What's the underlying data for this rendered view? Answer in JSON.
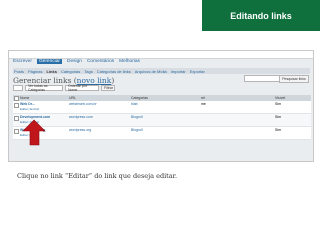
{
  "slide": {
    "title": "Editando links",
    "caption": "Clique no link “Editar” do link que deseja editar."
  },
  "menu": {
    "items": [
      "Escrever",
      "Gerenciar",
      "Design",
      "Comentários",
      "Melhorias"
    ],
    "active": "Gerenciar"
  },
  "submenu": {
    "items": [
      "Posts",
      "Páginas",
      "Links",
      "Categorias",
      "Tags",
      "Categorias de links",
      "Arquivos de Mídia",
      "Importar",
      "Exportar"
    ],
    "active": "Links"
  },
  "page": {
    "heading": "Gerenciar links (",
    "heading_link": "novo link",
    "heading_end": ")",
    "search_button": "Pesquisar links",
    "filter_category": "Ver todas as Categorias",
    "filter_order": "Ordenar por Nome",
    "filter_button": "Filtrar"
  },
  "table": {
    "headers": [
      "Nome",
      "URL",
      "Categorias",
      "rel",
      "Visível"
    ],
    "rows": [
      {
        "name": "Web Dr...",
        "url": "webdrweb.com.br",
        "cat": "blab",
        "rel": "me",
        "vis": "Sim",
        "actions": "Editar | Excluir"
      },
      {
        "name": "Development.com",
        "url": "wordpress.com",
        "cat": "Blogroll",
        "rel": "",
        "vis": "Sim",
        "actions": "Editar | Excluir"
      },
      {
        "name": "WordPress.org",
        "url": "wordpress.org",
        "cat": "Blogroll",
        "rel": "",
        "vis": "Sim",
        "actions": "Editar | Excluir"
      }
    ]
  },
  "colors": {
    "accent": "#0f6f3d",
    "arrow": "#c0151b"
  },
  "icons": {
    "arrow": "red-arrow-icon"
  }
}
